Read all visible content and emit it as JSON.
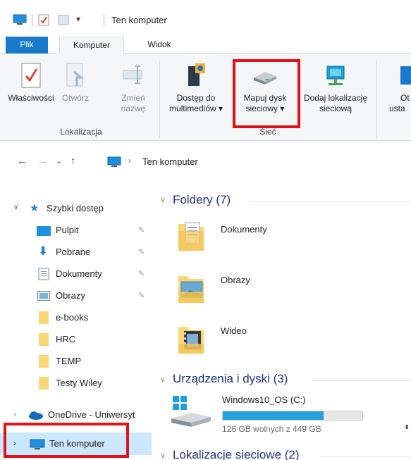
{
  "window": {
    "title": "Ten komputer"
  },
  "ribbon": {
    "tabs": {
      "file": "Plik",
      "computer": "Komputer",
      "view": "Widok"
    },
    "buttons": {
      "properties": "Właściwości",
      "open": "Otwórz",
      "rename_line1": "Zmień",
      "rename_line2": "nazwę",
      "media_line1": "Dostęp do",
      "media_line2": "multimediów",
      "map_line1": "Mapuj dysk",
      "map_line2": "sieciowy",
      "addloc_line1": "Dodaj lokalizację",
      "addloc_line2": "sieciową",
      "open_settings_line1": "Ot",
      "open_settings_line2": "usta"
    },
    "groups": {
      "location": "Lokalizacja",
      "network": "Sieć"
    }
  },
  "address": {
    "path": "Ten komputer"
  },
  "nav": {
    "quick_access": "Szybki dostęp",
    "items": [
      {
        "label": "Pulpit",
        "pinned": true
      },
      {
        "label": "Pobrane",
        "pinned": true
      },
      {
        "label": "Dokumenty",
        "pinned": true
      },
      {
        "label": "Obrazy",
        "pinned": true
      },
      {
        "label": "e-books",
        "pinned": false
      },
      {
        "label": "HRC",
        "pinned": false
      },
      {
        "label": "TEMP",
        "pinned": false
      },
      {
        "label": "Testy Wiley",
        "pinned": false
      }
    ],
    "onedrive": "OneDrive - Uniwersyt",
    "this_pc": "Ten komputer"
  },
  "main": {
    "folders_header": "Foldery (7)",
    "folders": [
      "Dokumenty",
      "Obrazy",
      "Wideo"
    ],
    "devices_header": "Urządzenia i dyski (3)",
    "drive": {
      "name": "Windows10_OS (C:)",
      "free_text": "126 GB wolnych z 449 GB",
      "used_fraction": 0.72
    },
    "network_header": "Lokalizacje sieciowe (2)"
  },
  "colors": {
    "accent": "#1979ca",
    "highlight": "#e3111a",
    "selected": "#cce8ff",
    "section": "#1e3287"
  }
}
